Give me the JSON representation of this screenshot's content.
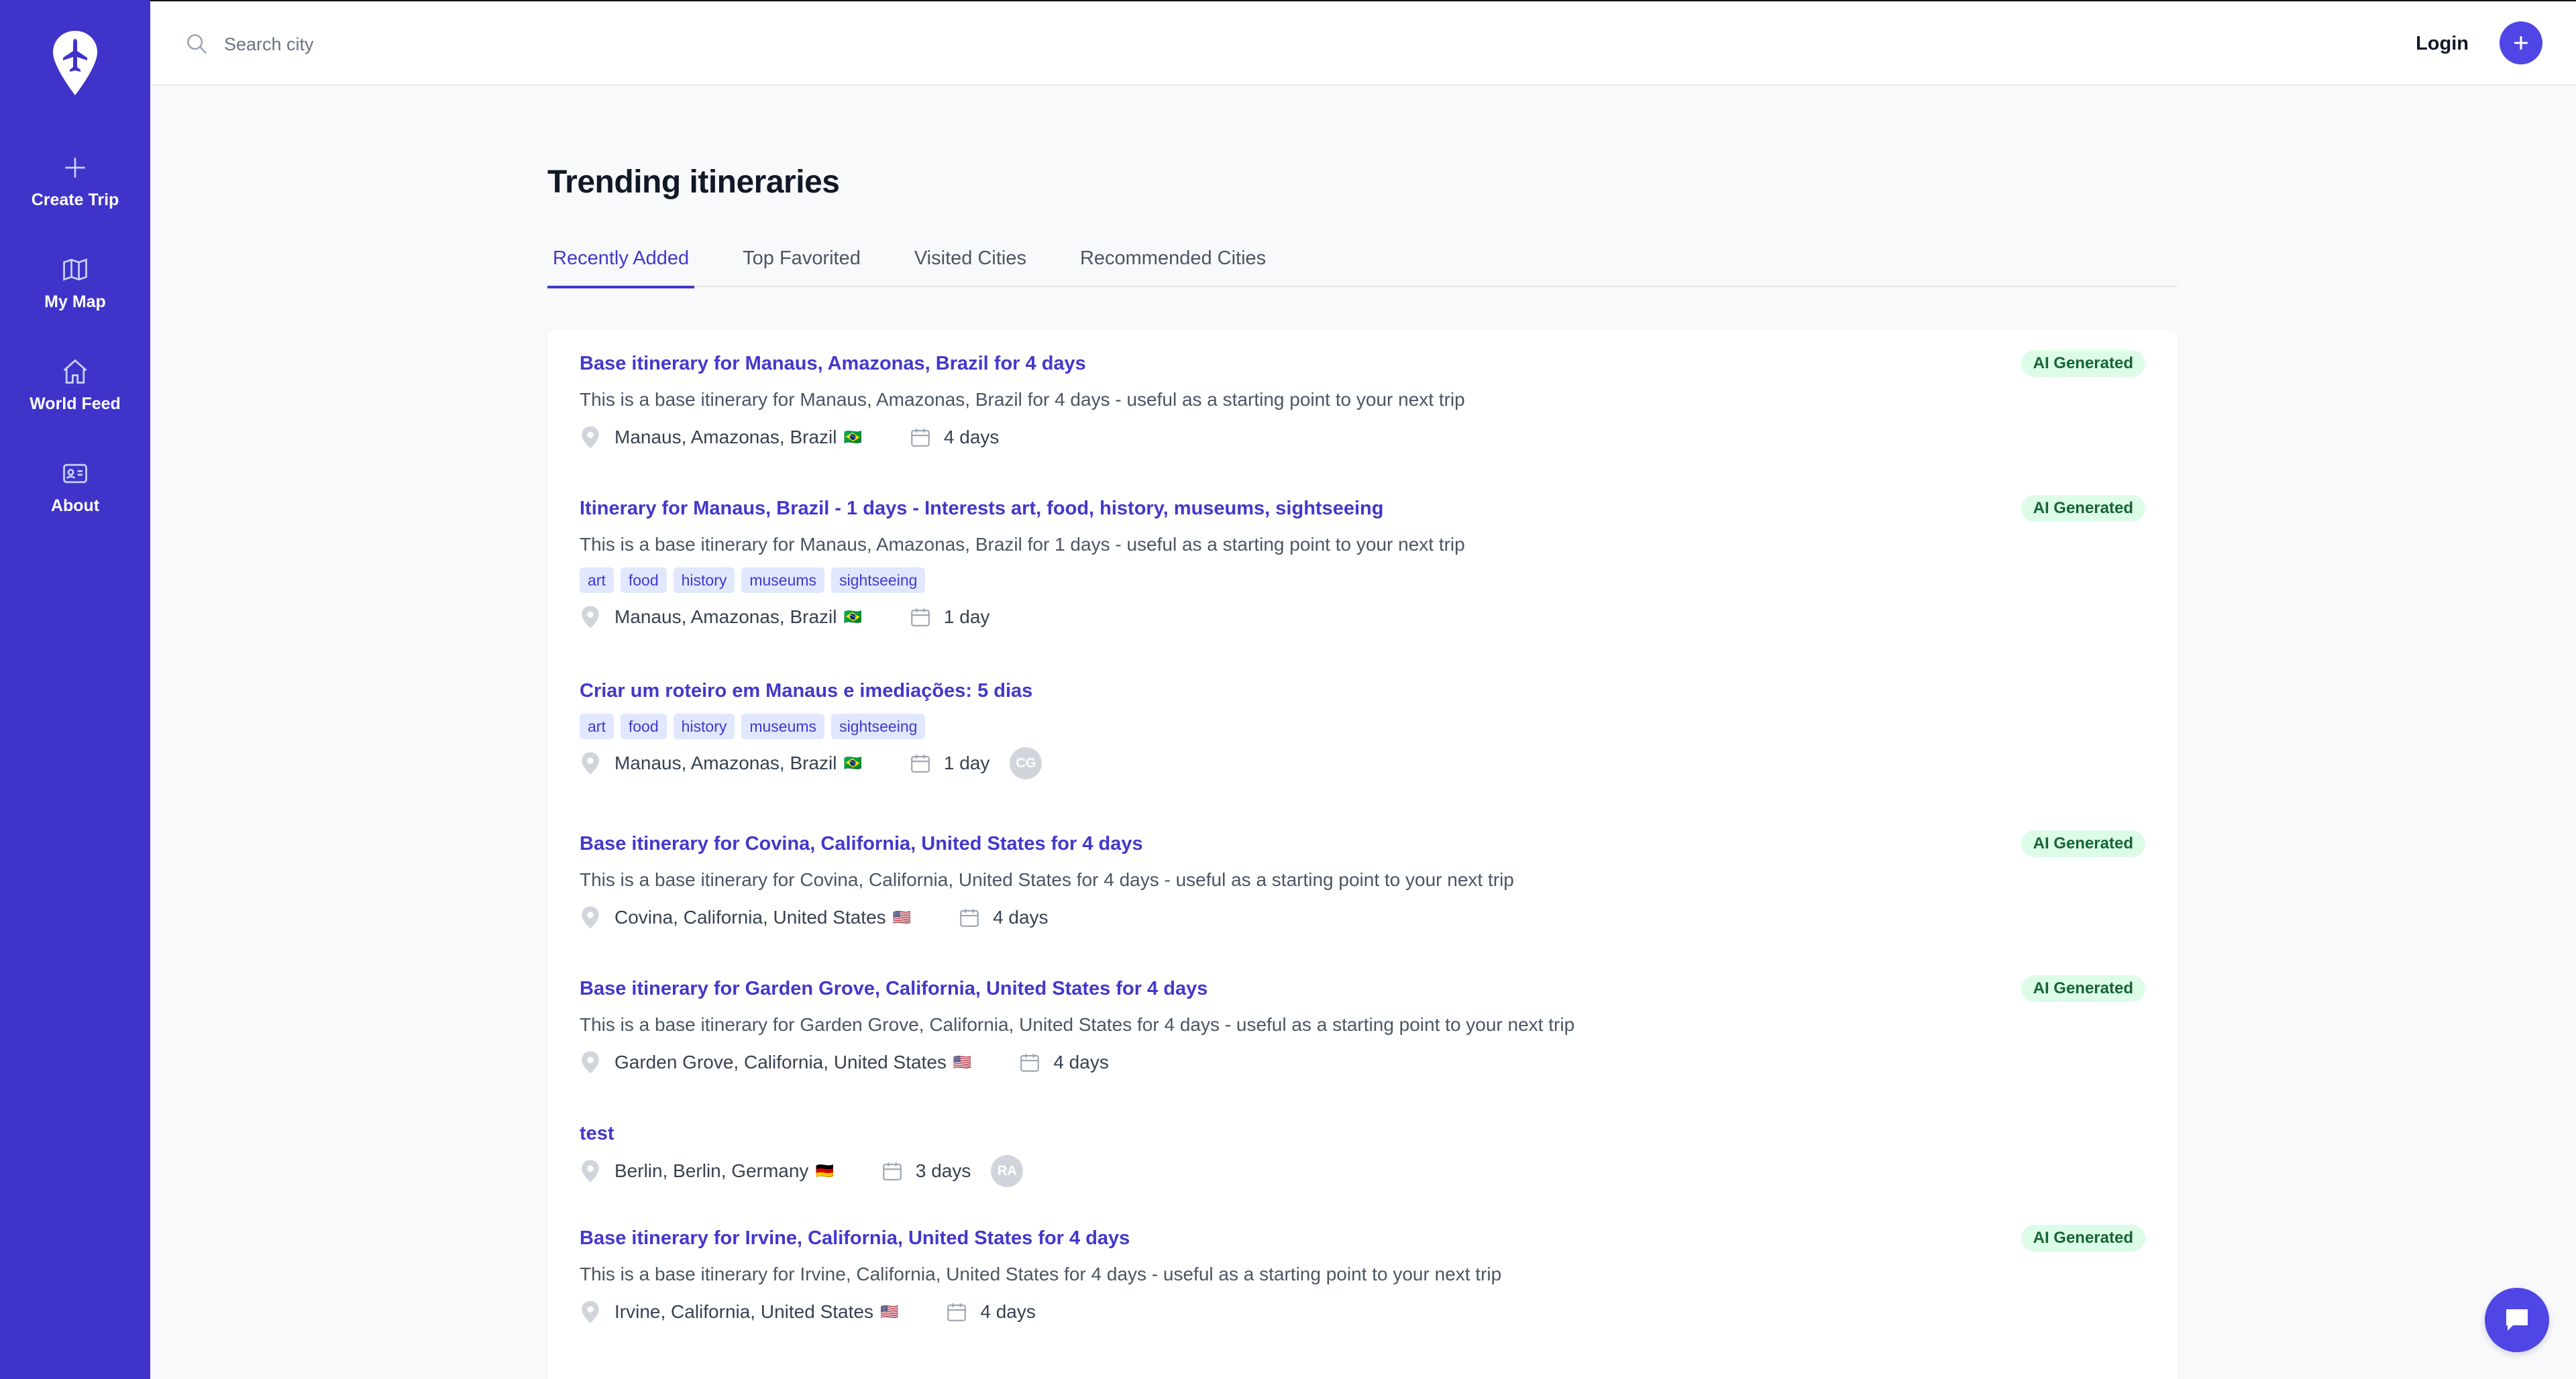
{
  "sidebar": {
    "logo": "plane-pin-logo",
    "items": [
      {
        "label": "Create Trip",
        "icon": "plus-icon"
      },
      {
        "label": "My Map",
        "icon": "map-icon"
      },
      {
        "label": "World Feed",
        "icon": "home-icon"
      },
      {
        "label": "About",
        "icon": "id-card-icon"
      }
    ]
  },
  "topbar": {
    "search_placeholder": "Search city",
    "login_label": "Login"
  },
  "main": {
    "title": "Trending itineraries",
    "tabs": [
      {
        "label": "Recently Added",
        "active": true
      },
      {
        "label": "Top Favorited",
        "active": false
      },
      {
        "label": "Visited Cities",
        "active": false
      },
      {
        "label": "Recommended Cities",
        "active": false
      }
    ],
    "items": [
      {
        "title": "Base itinerary for Manaus, Amazonas, Brazil for 4 days",
        "badge": "AI Generated",
        "description": "This is a base itinerary for Manaus, Amazonas, Brazil for 4 days - useful as a starting point to your next trip",
        "location": "Manaus, Amazonas, Brazil",
        "flag": "🇧🇷",
        "duration": "4 days"
      },
      {
        "title": "Itinerary for Manaus, Brazil - 1 days - Interests art, food, history, museums, sightseeing",
        "badge": "AI Generated",
        "description": "This is a base itinerary for Manaus, Amazonas, Brazil for 1 days - useful as a starting point to your next trip",
        "tags": [
          "art",
          "food",
          "history",
          "museums",
          "sightseeing"
        ],
        "location": "Manaus, Amazonas, Brazil",
        "flag": "🇧🇷",
        "duration": "1 day"
      },
      {
        "title": "Criar um roteiro em Manaus e imediações: 5 dias",
        "tags": [
          "art",
          "food",
          "history",
          "museums",
          "sightseeing"
        ],
        "location": "Manaus, Amazonas, Brazil",
        "flag": "🇧🇷",
        "duration": "1 day",
        "avatar": "CG"
      },
      {
        "title": "Base itinerary for Covina, California, United States for 4 days",
        "badge": "AI Generated",
        "description": "This is a base itinerary for Covina, California, United States for 4 days - useful as a starting point to your next trip",
        "location": "Covina, California, United States",
        "flag": "🇺🇸",
        "duration": "4 days"
      },
      {
        "title": "Base itinerary for Garden Grove, California, United States for 4 days",
        "badge": "AI Generated",
        "description": "This is a base itinerary for Garden Grove, California, United States for 4 days - useful as a starting point to your next trip",
        "location": "Garden Grove, California, United States",
        "flag": "🇺🇸",
        "duration": "4 days"
      },
      {
        "title": "test",
        "location": "Berlin, Berlin, Germany",
        "flag": "🇩🇪",
        "duration": "3 days",
        "avatar": "RA"
      },
      {
        "title": "Base itinerary for Irvine, California, United States for 4 days",
        "badge": "AI Generated",
        "description": "This is a base itinerary for Irvine, California, United States for 4 days - useful as a starting point to your next trip",
        "location": "Irvine, California, United States",
        "flag": "🇺🇸",
        "duration": "4 days"
      }
    ]
  },
  "colors": {
    "sidebar": "#3f33c9",
    "accent": "#4f46e5",
    "link": "#4338ca",
    "badge_bg": "#dcfce7",
    "badge_text": "#166534",
    "tag_bg": "#e0e7ff"
  }
}
